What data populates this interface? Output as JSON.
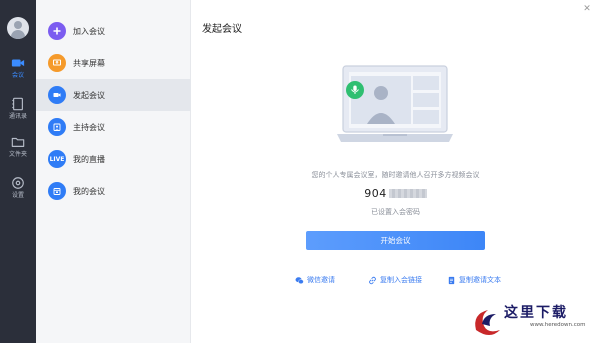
{
  "rail": {
    "items": [
      {
        "id": "meeting",
        "label": "会议",
        "icon": "video-camera-icon",
        "active": true
      },
      {
        "id": "contacts",
        "label": "通讯录",
        "icon": "address-book-icon",
        "active": false
      },
      {
        "id": "files",
        "label": "文件夹",
        "icon": "folder-icon",
        "active": false
      },
      {
        "id": "settings",
        "label": "设置",
        "icon": "gear-icon",
        "active": false
      }
    ]
  },
  "menu": {
    "items": [
      {
        "label": "加入会议",
        "icon": "plus-icon",
        "color": "#7b5cf0"
      },
      {
        "label": "共享屏幕",
        "icon": "share-screen-icon",
        "color": "#f59a2b"
      },
      {
        "label": "发起会议",
        "icon": "video-icon",
        "color": "#2f7cf6",
        "active": true
      },
      {
        "label": "主持会议",
        "icon": "host-icon",
        "color": "#2f7cf6"
      },
      {
        "label": "我的直播",
        "icon": "live-icon",
        "color": "#2f7cf6",
        "badge": "LIVE"
      },
      {
        "label": "我的会议",
        "icon": "calendar-icon",
        "color": "#2f7cf6"
      }
    ]
  },
  "main": {
    "title": "发起会议",
    "description": "您的个人专属会议室，随时邀请他人召开多方视频会议",
    "meeting_id_prefix": "904",
    "password_status": "已设置入会密码",
    "start_button": "开始会议",
    "links": [
      {
        "label": "微信邀请",
        "icon": "wechat-icon"
      },
      {
        "label": "复制入会链接",
        "icon": "link-icon"
      },
      {
        "label": "复制邀请文本",
        "icon": "document-icon"
      }
    ]
  },
  "watermark": {
    "text": "这里下载",
    "url": "www.heredown.com"
  },
  "colors": {
    "rail_bg": "#2b2f3a",
    "accent": "#3b8cff",
    "menu_bg": "#f5f6f8",
    "mic_green": "#2fbf71"
  }
}
